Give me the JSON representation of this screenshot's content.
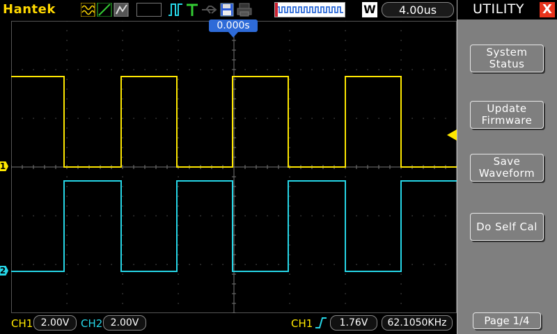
{
  "brand": "Hantek",
  "top": {
    "timebase_label": "W",
    "timebase_value": "4.00us",
    "trigger_pos": "0.000s"
  },
  "menu": {
    "title": "UTILITY",
    "close": "X",
    "buttons": [
      {
        "line1": "System",
        "line2": "Status"
      },
      {
        "line1": "Update",
        "line2": "Firmware"
      },
      {
        "line1": "Save",
        "line2": "Waveform"
      },
      {
        "line1": "Do Self Cal",
        "line2": ""
      }
    ],
    "page": "Page 1/4"
  },
  "status": {
    "ch1_label": "CH1",
    "ch1_scale": "2.00V",
    "ch2_label": "CH2",
    "ch2_scale": "2.00V",
    "trig_src": "CH1",
    "trig_level": "1.76V",
    "frequency": "62.1050KHz"
  },
  "markers": {
    "ch1": "1",
    "ch2": "2"
  },
  "colors": {
    "ch1": "#ffe800",
    "ch2": "#26d7e8",
    "brand": "#ffd800",
    "trigger": "#2e6bd8"
  }
}
